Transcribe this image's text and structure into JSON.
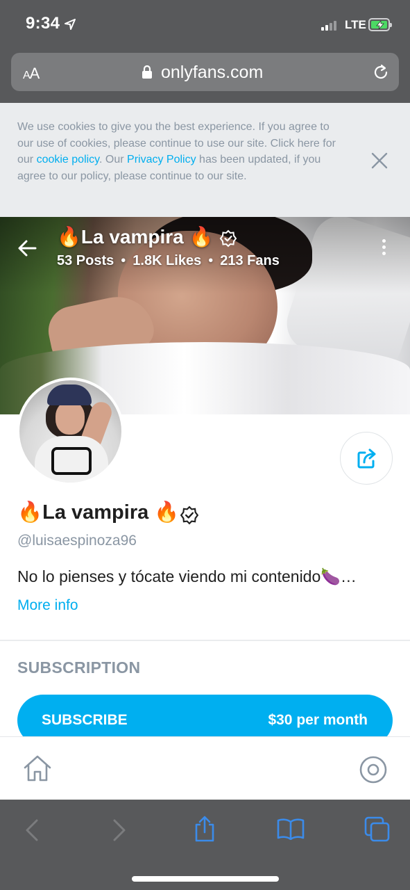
{
  "status_bar": {
    "time": "9:34",
    "network": "LTE",
    "battery_charging": true
  },
  "browser": {
    "text_size_label": "AA",
    "url": "onlyfans.com"
  },
  "cookie_banner": {
    "text_part1": "We use cookies to give you the best experience. If you agree to our use of cookies, please continue to use our site. Click here for our ",
    "cookie_link": "cookie policy",
    "text_part2": ". Our ",
    "privacy_link": "Privacy Policy",
    "text_part3": " has been updated, if you agree to our policy, please continue to our site."
  },
  "cover": {
    "name": "🔥La vampira 🔥",
    "posts": "53 Posts",
    "likes": "1.8K Likes",
    "fans": "213 Fans",
    "separator": "•"
  },
  "profile": {
    "name": "🔥La vampira 🔥",
    "handle": "@luisaespinoza96",
    "bio": "No lo pienses y tócate viendo mi contenido🍆…",
    "more_info": "More info"
  },
  "subscription": {
    "heading": "SUBSCRIPTION",
    "button_label": "SUBSCRIBE",
    "price": "$30 per month"
  },
  "colors": {
    "accent": "#00aff0",
    "muted_text": "#8a96a3",
    "browser_chrome": "#58595b",
    "safari_icon_blue": "#3b8bea"
  },
  "icons": {
    "cover": [
      "back-arrow-icon",
      "verified-badge-icon",
      "more-dots-icon"
    ],
    "profile": [
      "share-icon",
      "verified-badge-icon"
    ],
    "app_nav": [
      "home-icon",
      "profile-icon"
    ],
    "safari": [
      "back-icon",
      "forward-icon",
      "share-icon",
      "bookmarks-icon",
      "tabs-icon"
    ]
  }
}
